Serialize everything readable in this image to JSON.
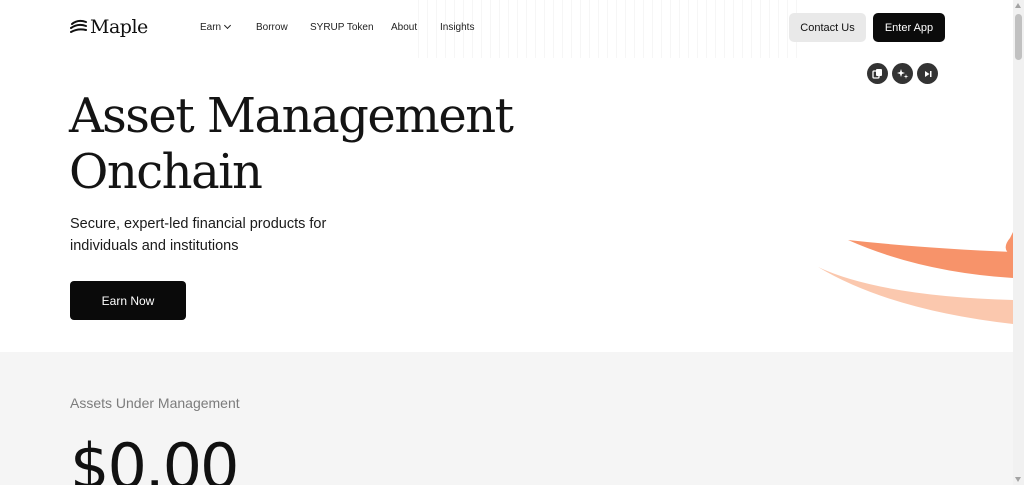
{
  "brand": {
    "name": "Maple"
  },
  "nav": {
    "items": [
      {
        "label": "Earn",
        "has_dropdown": true
      },
      {
        "label": "Borrow"
      },
      {
        "label": "SYRUP Token"
      },
      {
        "label": "About"
      },
      {
        "label": "Insights"
      }
    ]
  },
  "header": {
    "contact_label": "Contact Us",
    "enter_label": "Enter App"
  },
  "tools": [
    "copy-icon",
    "sparkle-icon",
    "skip-icon"
  ],
  "hero": {
    "title_line1": "Asset Management",
    "title_line2": "Onchain",
    "subtitle": "Secure, expert-led financial products for individuals and institutions",
    "cta_label": "Earn Now"
  },
  "stats": {
    "label": "Assets Under Management",
    "value": "$0.00"
  },
  "colors": {
    "accent_orange": "#f7936a",
    "accent_peach": "#fbc8ae",
    "primary": "#0b0b0b"
  }
}
